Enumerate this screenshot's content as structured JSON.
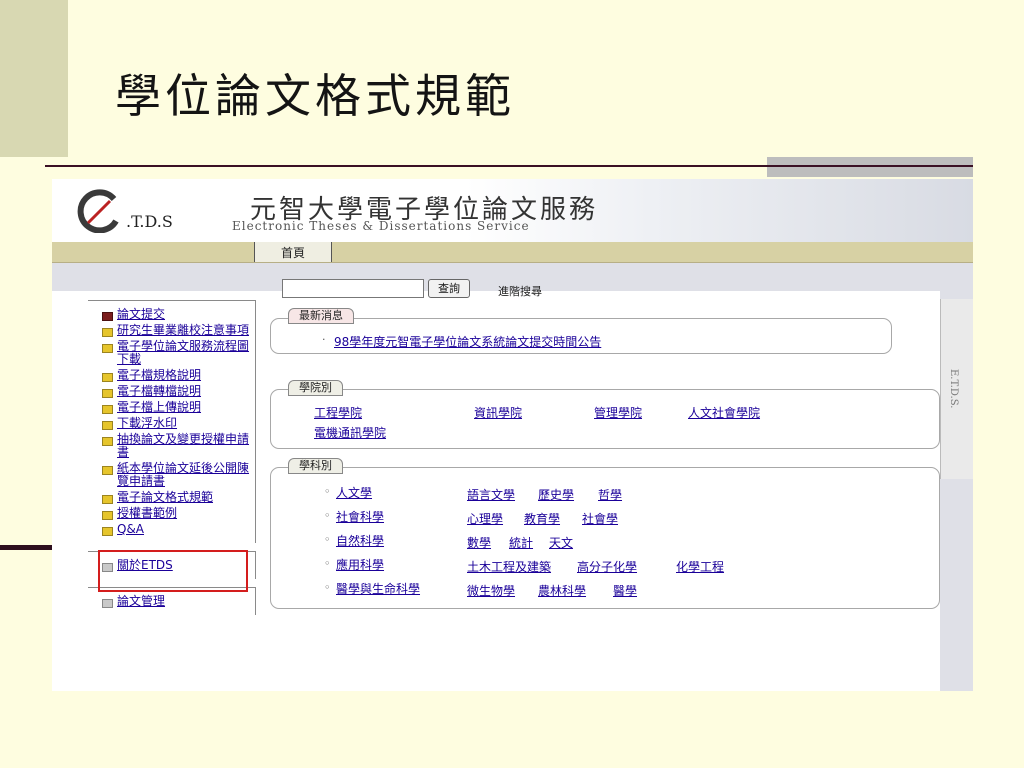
{
  "slide": {
    "title": "學位論文格式規範"
  },
  "banner": {
    "logo_text": ".T.D.S",
    "title": "元智大學電子學位論文服務",
    "subtitle": "Electronic Theses & Dissertations Service"
  },
  "nav": {
    "home": "首頁"
  },
  "search": {
    "value": "",
    "button": "查詢",
    "advanced": "進階搜尋"
  },
  "right_tab": "E.T.D.S.",
  "sidebar": {
    "submit": "論文提交",
    "items": [
      "研究生畢業離校注意事項",
      "電子學位論文服務流程圖下載",
      "電子檔規格說明",
      "電子檔轉檔說明",
      "電子檔上傳說明",
      "下載浮水印",
      "抽換論文及變更授權申請書",
      "紙本學位論文延後公開陳覽申請書",
      "電子論文格式規範",
      "授權書範例",
      "Q&A"
    ],
    "about": "關於ETDS",
    "manage": "論文管理"
  },
  "news": {
    "tab": "最新消息",
    "items": [
      "98學年度元智電子學位論文系統論文提交時間公告"
    ]
  },
  "colleges": {
    "tab": "學院別",
    "items": [
      "工程學院",
      "資訊學院",
      "管理學院",
      "人文社會學院",
      "電機通訊學院"
    ]
  },
  "disciplines": {
    "tab": "學科別",
    "rows": [
      {
        "head": "人文學",
        "subs": [
          "語言文學",
          "歷史學",
          "哲學"
        ]
      },
      {
        "head": "社會科學",
        "subs": [
          "心理學",
          "教育學",
          "社會學"
        ]
      },
      {
        "head": "自然科學",
        "subs": [
          "數學",
          "統計",
          "天文"
        ]
      },
      {
        "head": "應用科學",
        "subs": [
          "土木工程及建築",
          "高分子化學",
          "化學工程"
        ]
      },
      {
        "head": "醫學與生命科學",
        "subs": [
          "微生物學",
          "農林科學",
          "醫學"
        ]
      }
    ]
  }
}
